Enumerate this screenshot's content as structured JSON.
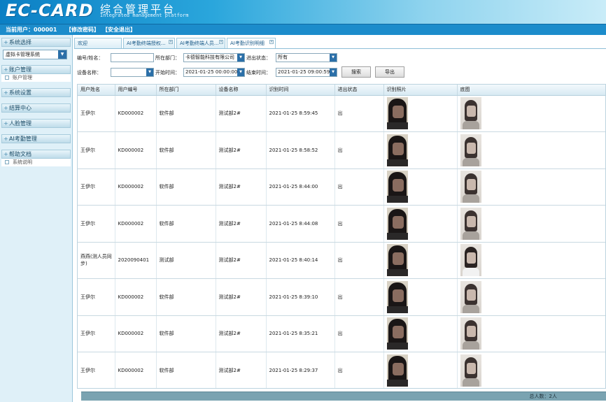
{
  "header": {
    "logo": "EC-CARD",
    "title_cn": "综合管理平台",
    "title_en": "Integrated management platform"
  },
  "userbar": {
    "current_user": "当前用户：000001",
    "change_password": "【修改密码】",
    "logout": "【安全退出】"
  },
  "sidebar": {
    "system_select_label": "系统选择",
    "system_select_value": "虚拟卡管理系统",
    "sections": [
      {
        "label": "账户管理",
        "items": [
          "账户管理"
        ]
      },
      {
        "label": "系统设置",
        "items": []
      },
      {
        "label": "结算中心",
        "items": []
      },
      {
        "label": "人脸管理",
        "items": []
      },
      {
        "label": "AI考勤管理",
        "items": []
      },
      {
        "label": "帮助文档",
        "items": [
          "系统说明"
        ]
      }
    ]
  },
  "tabs": [
    "欢迎",
    "AI考勤终端授权...",
    "AI考勤终端人员...",
    "AI考勤识别明细"
  ],
  "filters": {
    "id_name_label": "编号/姓名：",
    "id_name_value": "",
    "dept_label": "所在部门：",
    "dept_value": "卡德智能科技有限公司",
    "status_label": "进出状态：",
    "status_value": "所有",
    "device_label": "设备名称：",
    "device_value": "",
    "start_label": "开始时间：",
    "start_value": "2021-01-25 00:00:00",
    "end_label": "结束时间：",
    "end_value": "2021-01-25 09:00:59",
    "search_button": "搜索",
    "export_button": "导出"
  },
  "table": {
    "columns": [
      "用户姓名",
      "用户编号",
      "所在部门",
      "设备名称",
      "识别时间",
      "进出状态",
      "识别照片",
      "底图"
    ],
    "rows": [
      {
        "name": "王伊尔",
        "id": "KD000002",
        "dept": "软件部",
        "device": "测试部2#",
        "time": "2021-01-25 8:59:45",
        "status": "出",
        "base": "dark"
      },
      {
        "name": "王伊尔",
        "id": "KD000002",
        "dept": "软件部",
        "device": "测试部2#",
        "time": "2021-01-25 8:58:52",
        "status": "出",
        "base": "dark"
      },
      {
        "name": "王伊尔",
        "id": "KD000002",
        "dept": "软件部",
        "device": "测试部2#",
        "time": "2021-01-25 8:44:00",
        "status": "出",
        "base": "dark"
      },
      {
        "name": "王伊尔",
        "id": "KD000002",
        "dept": "软件部",
        "device": "测试部2#",
        "time": "2021-01-25 8:44:08",
        "status": "出",
        "base": "dark"
      },
      {
        "name": "燕燕(测人员同步)",
        "id": "2020090401",
        "dept": "测试部",
        "device": "测试部2#",
        "time": "2021-01-25 8:40:14",
        "status": "出",
        "base": "white"
      },
      {
        "name": "王伊尔",
        "id": "KD000002",
        "dept": "软件部",
        "device": "测试部2#",
        "time": "2021-01-25 8:39:10",
        "status": "出",
        "base": "dark"
      },
      {
        "name": "王伊尔",
        "id": "KD000002",
        "dept": "软件部",
        "device": "测试部2#",
        "time": "2021-01-25 8:35:21",
        "status": "出",
        "base": "dark"
      },
      {
        "name": "王伊尔",
        "id": "KD000002",
        "dept": "软件部",
        "device": "测试部2#",
        "time": "2021-01-25 8:29:37",
        "status": "出",
        "base": "dark"
      }
    ]
  },
  "footer": {
    "total": "总人数：2人"
  },
  "colors": {
    "header_start": "#0b7fc4",
    "userbar": "#1c8ccb",
    "sidebar_bg": "#dff0f8",
    "footer": "#7aa3b1"
  }
}
